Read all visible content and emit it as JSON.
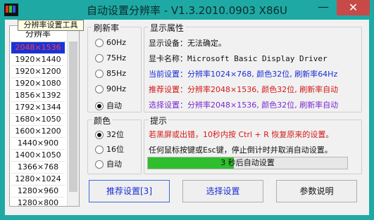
{
  "window": {
    "title": "自动设置分辨率 - V1.3.2010.0903 X86U",
    "minimize": "—",
    "close": "✕",
    "app_icon": "color-bars-icon"
  },
  "tooltip": "分辨率设置工具",
  "list": {
    "header": "分辨率",
    "selected": "2048×1536",
    "items": [
      "2048×1536",
      "1920×1440",
      "1920×1200",
      "1920×1080",
      "1856×1392",
      "1792×1344",
      "1680×1050",
      "1600×1200",
      "1440×900",
      "1400×1050",
      "1366×768",
      "1280×1024",
      "1280×960",
      "1280×800"
    ]
  },
  "refresh": {
    "label": "刷新率",
    "options": [
      "60Hz",
      "75Hz",
      "85Hz",
      "90Hz",
      "自动"
    ],
    "selected": "自动"
  },
  "color": {
    "label": "颜色",
    "options": [
      "32位",
      "16位",
      "自动"
    ],
    "selected": "32位"
  },
  "display": {
    "label": "显示属性",
    "device_label": "显示设备：",
    "device_value": "无法确定。",
    "card_label": "显卡名称：",
    "card_value": "Microsoft Basic Display Driver",
    "current": "当前设置：分辨率1024×768, 颜色32位, 刷新率64Hz",
    "recommended": "推荐设置：分辨率2048×1536, 颜色32位, 刷新率自动",
    "chosen": "选择设置：分辨率2048×1536, 颜色32位, 刷新率自动"
  },
  "hint": {
    "label": "提示",
    "line1": "若黑屏或出错，10秒内按 Ctrl + R 恢复原来的设置。",
    "line2": "任何鼠标按键或Esc键，停止倒计时并取消自动设置。",
    "progress_text": "3 秒后自动设置",
    "progress_fraction": 0.43
  },
  "buttons": {
    "recommend": "推荐设置[3]",
    "select": "选择设置",
    "help": "参数说明"
  },
  "colors": {
    "titlebar": "#1fa9a4",
    "close": "#c74a48",
    "current_text": "#1a2ed4",
    "recommended_text": "#d41818",
    "chosen_text": "#7c2ad1",
    "hint_text": "#d41818",
    "selection": "#1833d8",
    "progress": "#2fbe2d"
  }
}
